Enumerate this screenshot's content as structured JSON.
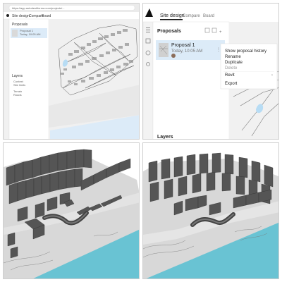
{
  "panel1": {
    "address": "https://app.autodeskforma.com/projects/...",
    "tabs": [
      "Site design",
      "Compare",
      "Board"
    ],
    "active_tab": "Site design",
    "proposals_title": "Proposals",
    "proposal_name": "Proposal 1",
    "proposal_time": "Today, 10:05 AM",
    "layers_title": "Layers",
    "layer_items": [
      "Context",
      "Site limits",
      "Terrain",
      "Roads"
    ]
  },
  "panel2": {
    "tabs": [
      "Site design",
      "Compare",
      "Board"
    ],
    "active_tab": "Site design",
    "proposals_title": "Proposals",
    "proposal_name": "Proposal 1",
    "proposal_time": "Today, 10:05 AM",
    "layers_title": "Layers",
    "context_menu": {
      "items": [
        {
          "label": "Show proposal history",
          "enabled": true
        },
        {
          "label": "Rename",
          "enabled": true
        },
        {
          "label": "Duplicate",
          "enabled": true
        },
        {
          "label": "Delete",
          "enabled": false
        },
        {
          "label": "Revit",
          "enabled": true,
          "submenu": true
        },
        {
          "label": "Export",
          "enabled": true
        }
      ]
    }
  },
  "colors": {
    "accent": "#dcebf8",
    "water": "#69c3d3",
    "terrain": "#d8d8d8",
    "building": "#4a4a4a"
  }
}
